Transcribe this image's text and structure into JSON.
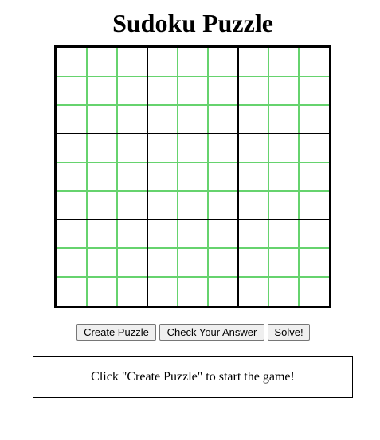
{
  "title": "Sudoku Puzzle",
  "board": {
    "rows": 9,
    "cols": 9,
    "box_size": 3,
    "cells": [
      [
        "",
        "",
        "",
        "",
        "",
        "",
        "",
        "",
        ""
      ],
      [
        "",
        "",
        "",
        "",
        "",
        "",
        "",
        "",
        ""
      ],
      [
        "",
        "",
        "",
        "",
        "",
        "",
        "",
        "",
        ""
      ],
      [
        "",
        "",
        "",
        "",
        "",
        "",
        "",
        "",
        ""
      ],
      [
        "",
        "",
        "",
        "",
        "",
        "",
        "",
        "",
        ""
      ],
      [
        "",
        "",
        "",
        "",
        "",
        "",
        "",
        "",
        ""
      ],
      [
        "",
        "",
        "",
        "",
        "",
        "",
        "",
        "",
        ""
      ],
      [
        "",
        "",
        "",
        "",
        "",
        "",
        "",
        "",
        ""
      ],
      [
        "",
        "",
        "",
        "",
        "",
        "",
        "",
        "",
        ""
      ]
    ],
    "colors": {
      "cell_line": "#66d36e",
      "box_line": "#000000",
      "border": "#000000"
    }
  },
  "buttons": {
    "create_label": "Create Puzzle",
    "check_label": "Check Your Answer",
    "solve_label": "Solve!"
  },
  "message": "Click \"Create Puzzle\" to start the game!"
}
